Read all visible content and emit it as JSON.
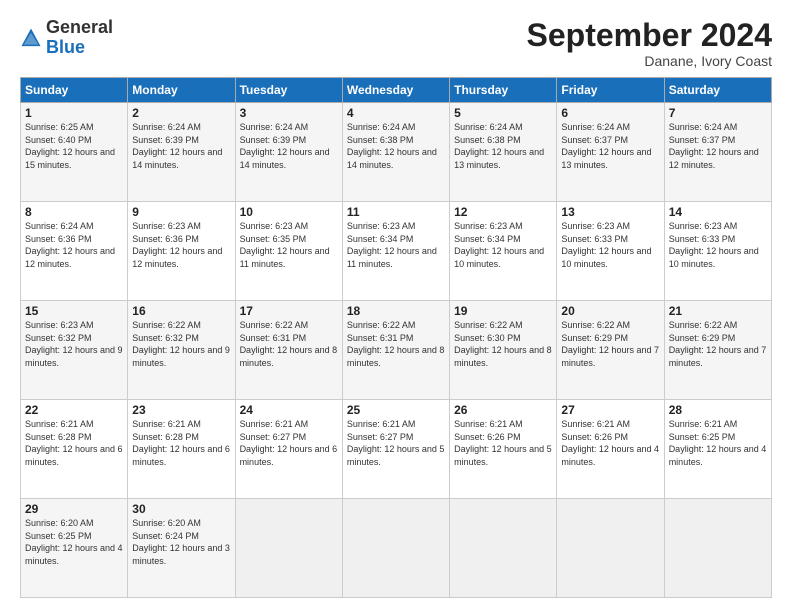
{
  "logo": {
    "general": "General",
    "blue": "Blue"
  },
  "header": {
    "month": "September 2024",
    "location": "Danane, Ivory Coast"
  },
  "weekdays": [
    "Sunday",
    "Monday",
    "Tuesday",
    "Wednesday",
    "Thursday",
    "Friday",
    "Saturday"
  ],
  "weeks": [
    [
      {
        "day": "1",
        "sunrise": "6:25 AM",
        "sunset": "6:40 PM",
        "daylight": "12 hours and 15 minutes."
      },
      {
        "day": "2",
        "sunrise": "6:24 AM",
        "sunset": "6:39 PM",
        "daylight": "12 hours and 14 minutes."
      },
      {
        "day": "3",
        "sunrise": "6:24 AM",
        "sunset": "6:39 PM",
        "daylight": "12 hours and 14 minutes."
      },
      {
        "day": "4",
        "sunrise": "6:24 AM",
        "sunset": "6:38 PM",
        "daylight": "12 hours and 14 minutes."
      },
      {
        "day": "5",
        "sunrise": "6:24 AM",
        "sunset": "6:38 PM",
        "daylight": "12 hours and 13 minutes."
      },
      {
        "day": "6",
        "sunrise": "6:24 AM",
        "sunset": "6:37 PM",
        "daylight": "12 hours and 13 minutes."
      },
      {
        "day": "7",
        "sunrise": "6:24 AM",
        "sunset": "6:37 PM",
        "daylight": "12 hours and 12 minutes."
      }
    ],
    [
      {
        "day": "8",
        "sunrise": "6:24 AM",
        "sunset": "6:36 PM",
        "daylight": "12 hours and 12 minutes."
      },
      {
        "day": "9",
        "sunrise": "6:23 AM",
        "sunset": "6:36 PM",
        "daylight": "12 hours and 12 minutes."
      },
      {
        "day": "10",
        "sunrise": "6:23 AM",
        "sunset": "6:35 PM",
        "daylight": "12 hours and 11 minutes."
      },
      {
        "day": "11",
        "sunrise": "6:23 AM",
        "sunset": "6:34 PM",
        "daylight": "12 hours and 11 minutes."
      },
      {
        "day": "12",
        "sunrise": "6:23 AM",
        "sunset": "6:34 PM",
        "daylight": "12 hours and 10 minutes."
      },
      {
        "day": "13",
        "sunrise": "6:23 AM",
        "sunset": "6:33 PM",
        "daylight": "12 hours and 10 minutes."
      },
      {
        "day": "14",
        "sunrise": "6:23 AM",
        "sunset": "6:33 PM",
        "daylight": "12 hours and 10 minutes."
      }
    ],
    [
      {
        "day": "15",
        "sunrise": "6:23 AM",
        "sunset": "6:32 PM",
        "daylight": "12 hours and 9 minutes."
      },
      {
        "day": "16",
        "sunrise": "6:22 AM",
        "sunset": "6:32 PM",
        "daylight": "12 hours and 9 minutes."
      },
      {
        "day": "17",
        "sunrise": "6:22 AM",
        "sunset": "6:31 PM",
        "daylight": "12 hours and 8 minutes."
      },
      {
        "day": "18",
        "sunrise": "6:22 AM",
        "sunset": "6:31 PM",
        "daylight": "12 hours and 8 minutes."
      },
      {
        "day": "19",
        "sunrise": "6:22 AM",
        "sunset": "6:30 PM",
        "daylight": "12 hours and 8 minutes."
      },
      {
        "day": "20",
        "sunrise": "6:22 AM",
        "sunset": "6:29 PM",
        "daylight": "12 hours and 7 minutes."
      },
      {
        "day": "21",
        "sunrise": "6:22 AM",
        "sunset": "6:29 PM",
        "daylight": "12 hours and 7 minutes."
      }
    ],
    [
      {
        "day": "22",
        "sunrise": "6:21 AM",
        "sunset": "6:28 PM",
        "daylight": "12 hours and 6 minutes."
      },
      {
        "day": "23",
        "sunrise": "6:21 AM",
        "sunset": "6:28 PM",
        "daylight": "12 hours and 6 minutes."
      },
      {
        "day": "24",
        "sunrise": "6:21 AM",
        "sunset": "6:27 PM",
        "daylight": "12 hours and 6 minutes."
      },
      {
        "day": "25",
        "sunrise": "6:21 AM",
        "sunset": "6:27 PM",
        "daylight": "12 hours and 5 minutes."
      },
      {
        "day": "26",
        "sunrise": "6:21 AM",
        "sunset": "6:26 PM",
        "daylight": "12 hours and 5 minutes."
      },
      {
        "day": "27",
        "sunrise": "6:21 AM",
        "sunset": "6:26 PM",
        "daylight": "12 hours and 4 minutes."
      },
      {
        "day": "28",
        "sunrise": "6:21 AM",
        "sunset": "6:25 PM",
        "daylight": "12 hours and 4 minutes."
      }
    ],
    [
      {
        "day": "29",
        "sunrise": "6:20 AM",
        "sunset": "6:25 PM",
        "daylight": "12 hours and 4 minutes."
      },
      {
        "day": "30",
        "sunrise": "6:20 AM",
        "sunset": "6:24 PM",
        "daylight": "12 hours and 3 minutes."
      },
      null,
      null,
      null,
      null,
      null
    ]
  ]
}
